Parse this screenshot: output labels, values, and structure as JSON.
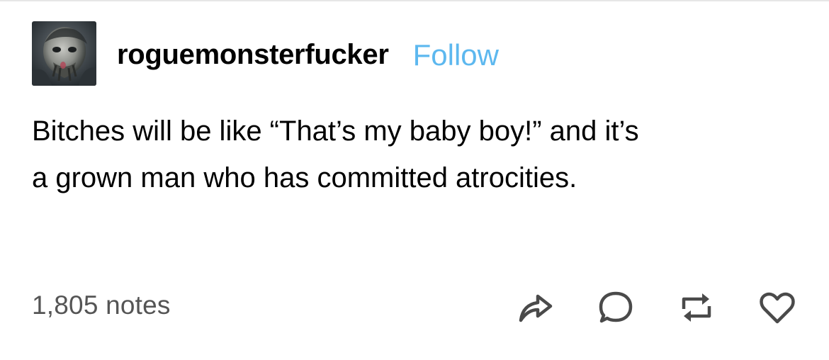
{
  "post": {
    "username": "roguemonsterfucker",
    "follow_label": "Follow",
    "avatar_icon": "avatar-image",
    "body_lines": [
      "Bitches will be like “That’s my baby boy!” and it’s",
      "a grown man who has committed atrocities."
    ],
    "notes_label": "1,805 notes"
  },
  "actions": [
    {
      "name": "share-icon"
    },
    {
      "name": "reply-icon"
    },
    {
      "name": "reblog-icon"
    },
    {
      "name": "like-icon"
    }
  ],
  "colors": {
    "follow": "#5db8ef",
    "notes": "#555555",
    "icons": "#4a4a4a",
    "text": "#000000",
    "background": "#ffffff"
  }
}
